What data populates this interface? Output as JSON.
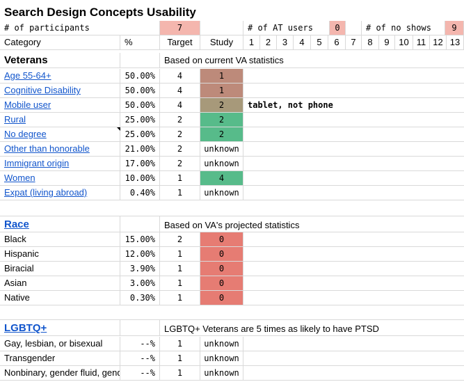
{
  "colors": {
    "pink": "#f4b6ae",
    "red": "#e67c73",
    "brown": "#bd8a7a",
    "olive": "#a7997a",
    "green": "#57bb8a",
    "link": "#1155cc",
    "grid": "#d9d9d9"
  },
  "title": "Search Design Concepts Usability",
  "header": {
    "participants_label": "# of participants",
    "participants_value": "7",
    "at_users_label": "# of AT users",
    "at_users_value": "0",
    "no_shows_label": "# of no shows",
    "no_shows_value": "9",
    "col_category": "Category",
    "col_percent": "%",
    "col_target": "Target",
    "col_study": "Study",
    "session_numbers": [
      "1",
      "2",
      "3",
      "4",
      "5",
      "6",
      "7",
      "8",
      "9",
      "10",
      "11",
      "12",
      "13"
    ]
  },
  "veterans": {
    "heading": "Veterans",
    "note": "Based on current VA statistics",
    "rows": [
      {
        "category": "Age 55-64+",
        "percent": "50.00%",
        "target": "4",
        "study": "1",
        "comment": ""
      },
      {
        "category": "Cognitive Disability",
        "percent": "50.00%",
        "target": "4",
        "study": "1",
        "comment": ""
      },
      {
        "category": "Mobile user",
        "percent": "50.00%",
        "target": "4",
        "study": "2",
        "comment": "tablet, not phone"
      },
      {
        "category": "Rural",
        "percent": "25.00%",
        "target": "2",
        "study": "2",
        "comment": ""
      },
      {
        "category": "No degree",
        "percent": "25.00%",
        "target": "2",
        "study": "2",
        "comment": ""
      },
      {
        "category": "Other than honorable",
        "percent": "21.00%",
        "target": "2",
        "study": "unknown",
        "comment": ""
      },
      {
        "category": "Immigrant origin",
        "percent": "17.00%",
        "target": "2",
        "study": "unknown",
        "comment": ""
      },
      {
        "category": "Women",
        "percent": "10.00%",
        "target": "1",
        "study": "4",
        "comment": ""
      },
      {
        "category": "Expat (living abroad)",
        "percent": "0.40%",
        "target": "1",
        "study": "unknown",
        "comment": ""
      }
    ]
  },
  "race": {
    "heading": "Race",
    "note": "Based on VA's projected statistics",
    "rows": [
      {
        "category": "Black",
        "percent": "15.00%",
        "target": "2",
        "study": "0"
      },
      {
        "category": "Hispanic",
        "percent": "12.00%",
        "target": "1",
        "study": "0"
      },
      {
        "category": "Biracial",
        "percent": "3.90%",
        "target": "1",
        "study": "0"
      },
      {
        "category": "Asian",
        "percent": "3.00%",
        "target": "1",
        "study": "0"
      },
      {
        "category": "Native",
        "percent": "0.30%",
        "target": "1",
        "study": "0"
      }
    ]
  },
  "lgbtq": {
    "heading": "LGBTQ+",
    "note": "LGBTQ+ Veterans are 5 times as likely to have PTSD",
    "rows": [
      {
        "category": "Gay, lesbian, or bisexual",
        "percent": "--%",
        "target": "1",
        "study": "unknown"
      },
      {
        "category": "Transgender",
        "percent": "--%",
        "target": "1",
        "study": "unknown"
      },
      {
        "category": "Nonbinary, gender fluid, genderqueer",
        "percent": "--%",
        "target": "1",
        "study": "unknown"
      }
    ]
  }
}
